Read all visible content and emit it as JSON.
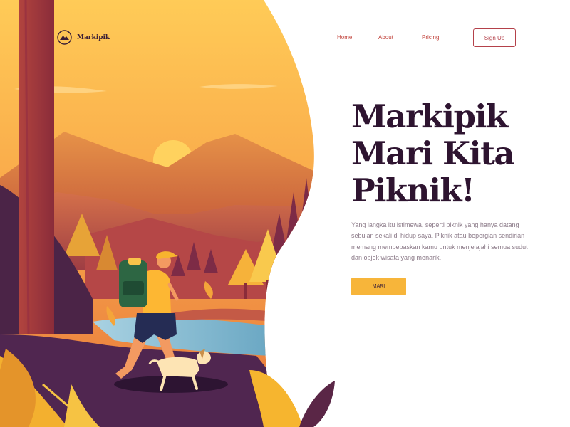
{
  "brand": {
    "name": "Markipik",
    "logo_icon": "mountain-logo-icon"
  },
  "nav": {
    "links": [
      "Home",
      "About",
      "Pricing"
    ],
    "signup_label": "Sign Up"
  },
  "hero": {
    "headline_lines": [
      "Markipik",
      "Mari Kita",
      "Piknik!"
    ],
    "description": "Yang langka itu istimewa, seperti piknik yang hanya datang sebulan sekali di hidup saya. Piknik atau bepergian sendirian memang membebaskan kamu untuk menjelajahi semua sudut dan objek wisata yang menarik.",
    "cta_label": "MARI"
  },
  "colors": {
    "accent": "#f7b53a",
    "nav_link": "#c2453e",
    "heading": "#2e1430",
    "body_text": "#8b7a88",
    "button_border": "#b4414a"
  }
}
